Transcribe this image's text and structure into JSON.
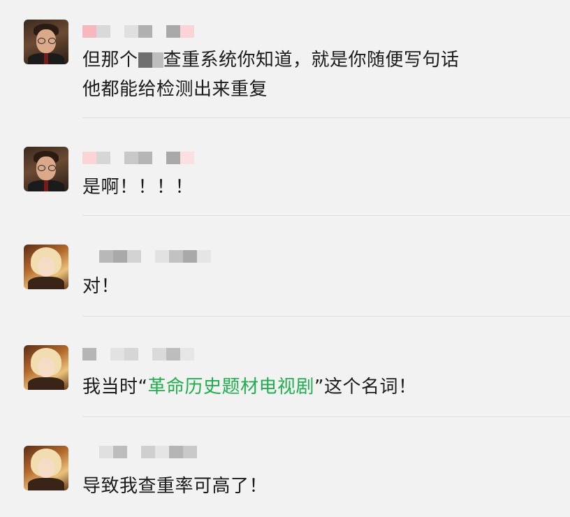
{
  "messages": [
    {
      "sender": "harry",
      "lines": [
        "但那个",
        "查重系统你知道，就是你随便写句话",
        "他都能给检测出来重复"
      ]
    },
    {
      "sender": "harry",
      "lines": [
        "是啊！！！！"
      ]
    },
    {
      "sender": "anime",
      "lines": [
        "对！"
      ]
    },
    {
      "sender": "anime",
      "lines": [
        "我当时",
        "“",
        "革命历史题材电视剧",
        "”这个名词！"
      ]
    },
    {
      "sender": "anime",
      "lines": [
        "导致我查重率可高了！"
      ]
    }
  ],
  "colors": {
    "background": "#f2f2f2",
    "highlight": "#22ad4f",
    "divider": "#e0e0e0"
  }
}
